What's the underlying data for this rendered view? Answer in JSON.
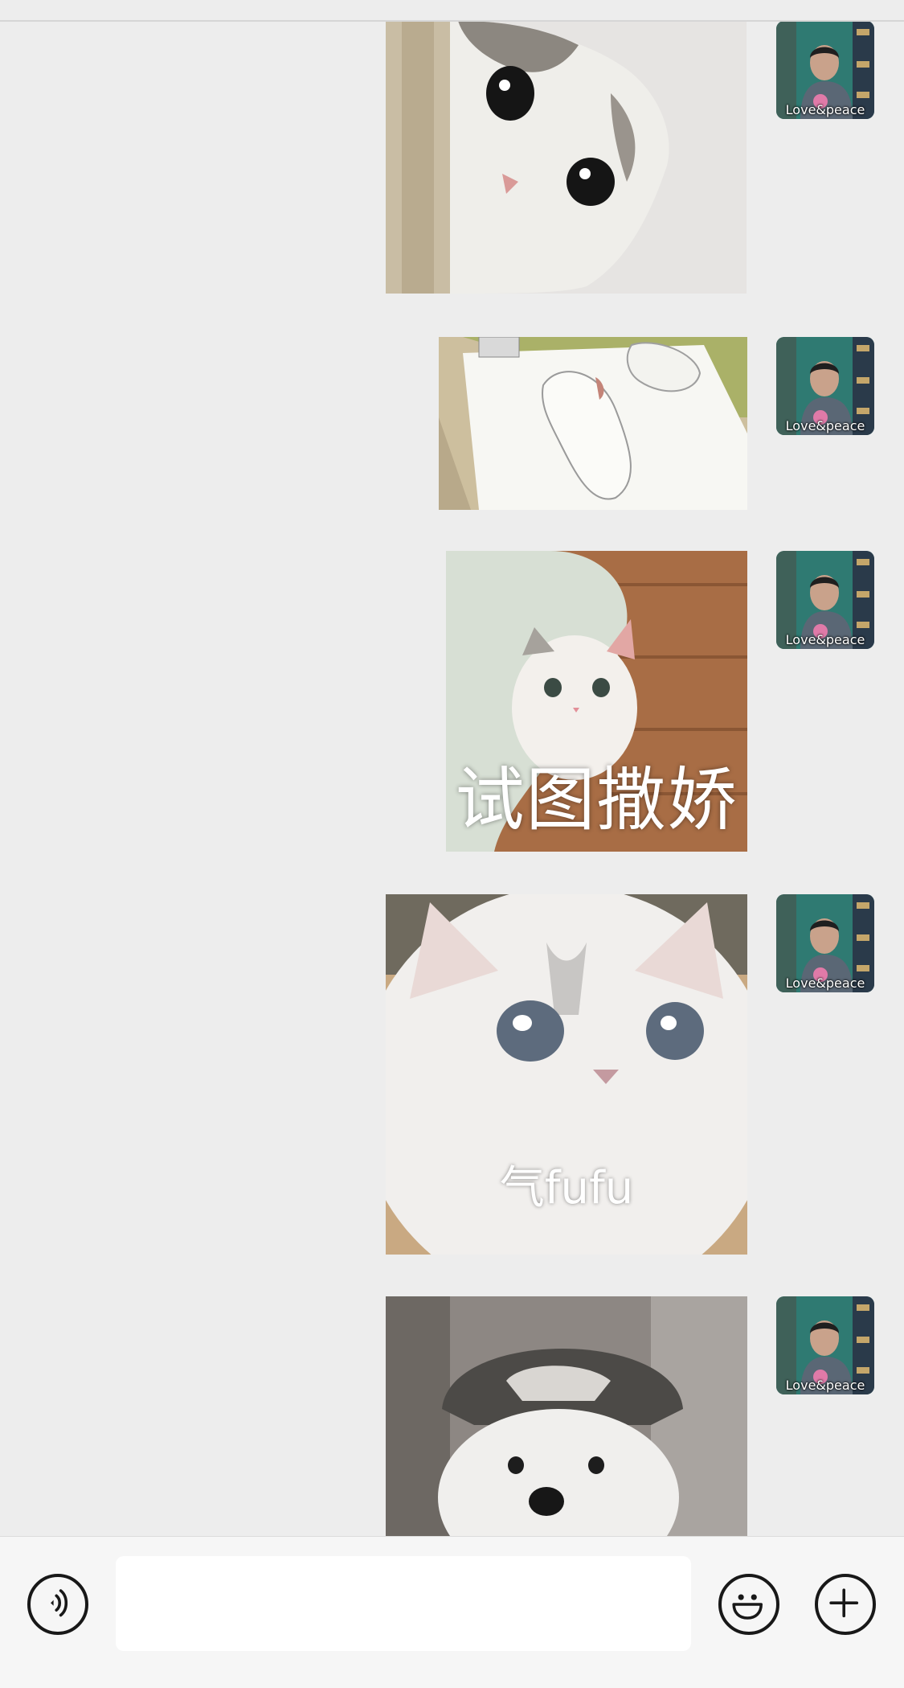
{
  "chat": {
    "avatar_caption": "Love&peace",
    "messages": [
      {
        "type": "sticker",
        "description": "grey-white cat peeking sideways"
      },
      {
        "type": "sticker",
        "description": "anime blanket roll on bed"
      },
      {
        "type": "sticker",
        "description": "white kitten under blanket",
        "caption": "试图撒娇"
      },
      {
        "type": "sticker",
        "description": "fluffy white cat close-up",
        "caption": "气fufu"
      },
      {
        "type": "sticker",
        "description": "white dog wearing hat"
      }
    ]
  },
  "input_bar": {
    "text_value": "",
    "placeholder": "",
    "icons": [
      "voice-icon",
      "emoji-icon",
      "plus-icon"
    ]
  },
  "colors": {
    "background": "#ededed",
    "input_bar_bg": "#f6f6f6",
    "icon_stroke": "#181818"
  }
}
